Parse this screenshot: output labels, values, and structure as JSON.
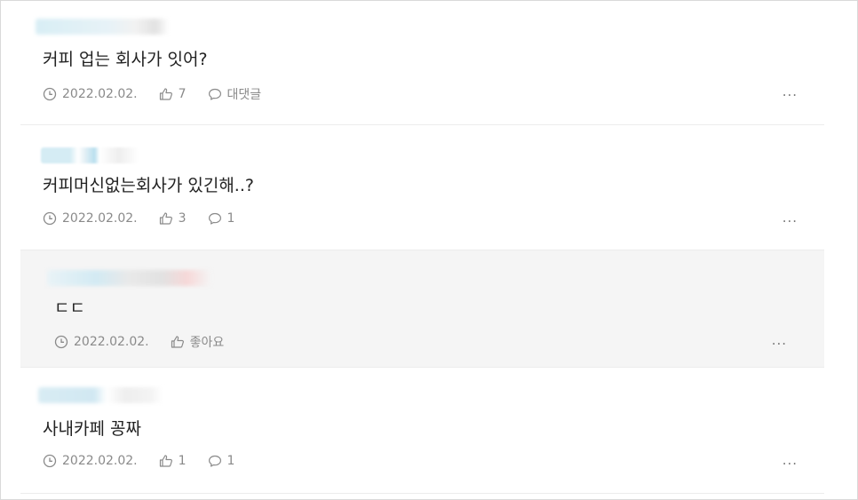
{
  "comments": [
    {
      "text": "커피 업는 회사가 잇어?",
      "date": "2022.02.02.",
      "likes": "7",
      "reply_label": "대댓글",
      "more": "..."
    },
    {
      "text": "커피머신없는회사가 있긴해..?",
      "date": "2022.02.02.",
      "likes": "3",
      "reply_label": "1",
      "more": "..."
    },
    {
      "text": "ㄷㄷ",
      "date": "2022.02.02.",
      "likes": "좋아요",
      "more": "..."
    },
    {
      "text": "사내카페 꽁짜",
      "date": "2022.02.02.",
      "likes": "1",
      "reply_label": "1",
      "more": "..."
    }
  ],
  "icons": {
    "date": "clock-icon",
    "like": "thumbs-up-icon",
    "reply": "speech-bubble-icon",
    "more": "more-options-icon"
  }
}
